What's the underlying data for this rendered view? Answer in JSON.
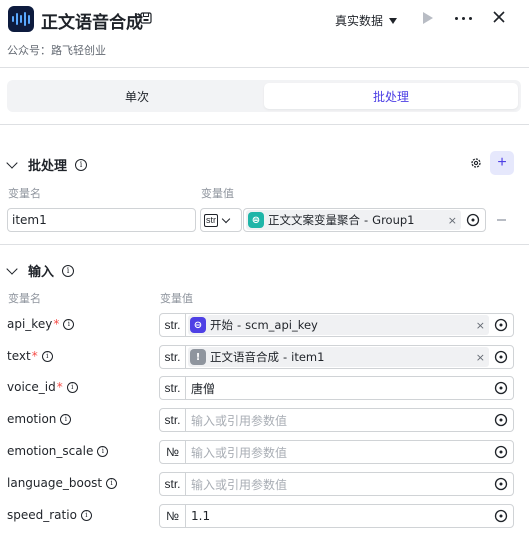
{
  "header": {
    "title": "正文语音合成",
    "data_mode": "真实数据",
    "subtitle": "公众号：路飞轻创业"
  },
  "tabs": [
    {
      "label": "单次",
      "active": false
    },
    {
      "label": "批处理",
      "active": true
    }
  ],
  "batch": {
    "title": "批处理",
    "col_name": "变量名",
    "col_value": "变量值",
    "row": {
      "name": "item1",
      "type": "str",
      "ref_node": "正文文案变量聚合",
      "ref_sep": " - ",
      "ref_var": "Group1"
    }
  },
  "input": {
    "title": "输入",
    "col_name": "变量名",
    "col_value": "变量值",
    "rows": [
      {
        "name": "api_key",
        "required": true,
        "type": "str.",
        "kind": "ref",
        "ref_node": "开始",
        "ref_var": "scm_api_key",
        "icon_color": "#4e40e5"
      },
      {
        "name": "text",
        "required": true,
        "type": "str.",
        "kind": "ref",
        "ref_node": "正文语音合成",
        "ref_var": "item1",
        "icon_color": "#8f959e"
      },
      {
        "name": "voice_id",
        "required": true,
        "type": "str.",
        "kind": "value",
        "value": "唐僧"
      },
      {
        "name": "emotion",
        "required": false,
        "type": "str.",
        "kind": "placeholder",
        "value": "输入或引用参数值"
      },
      {
        "name": "emotion_scale",
        "required": false,
        "type": "№",
        "kind": "placeholder",
        "value": "输入或引用参数值"
      },
      {
        "name": "language_boost",
        "required": false,
        "type": "str.",
        "kind": "placeholder",
        "value": "输入或引用参数值"
      },
      {
        "name": "speed_ratio",
        "required": false,
        "type": "№",
        "kind": "value",
        "value": "1.1"
      }
    ]
  },
  "colors": {
    "accent": "#4e40e5",
    "required": "#f54a45",
    "border": "#d0d3d6"
  }
}
